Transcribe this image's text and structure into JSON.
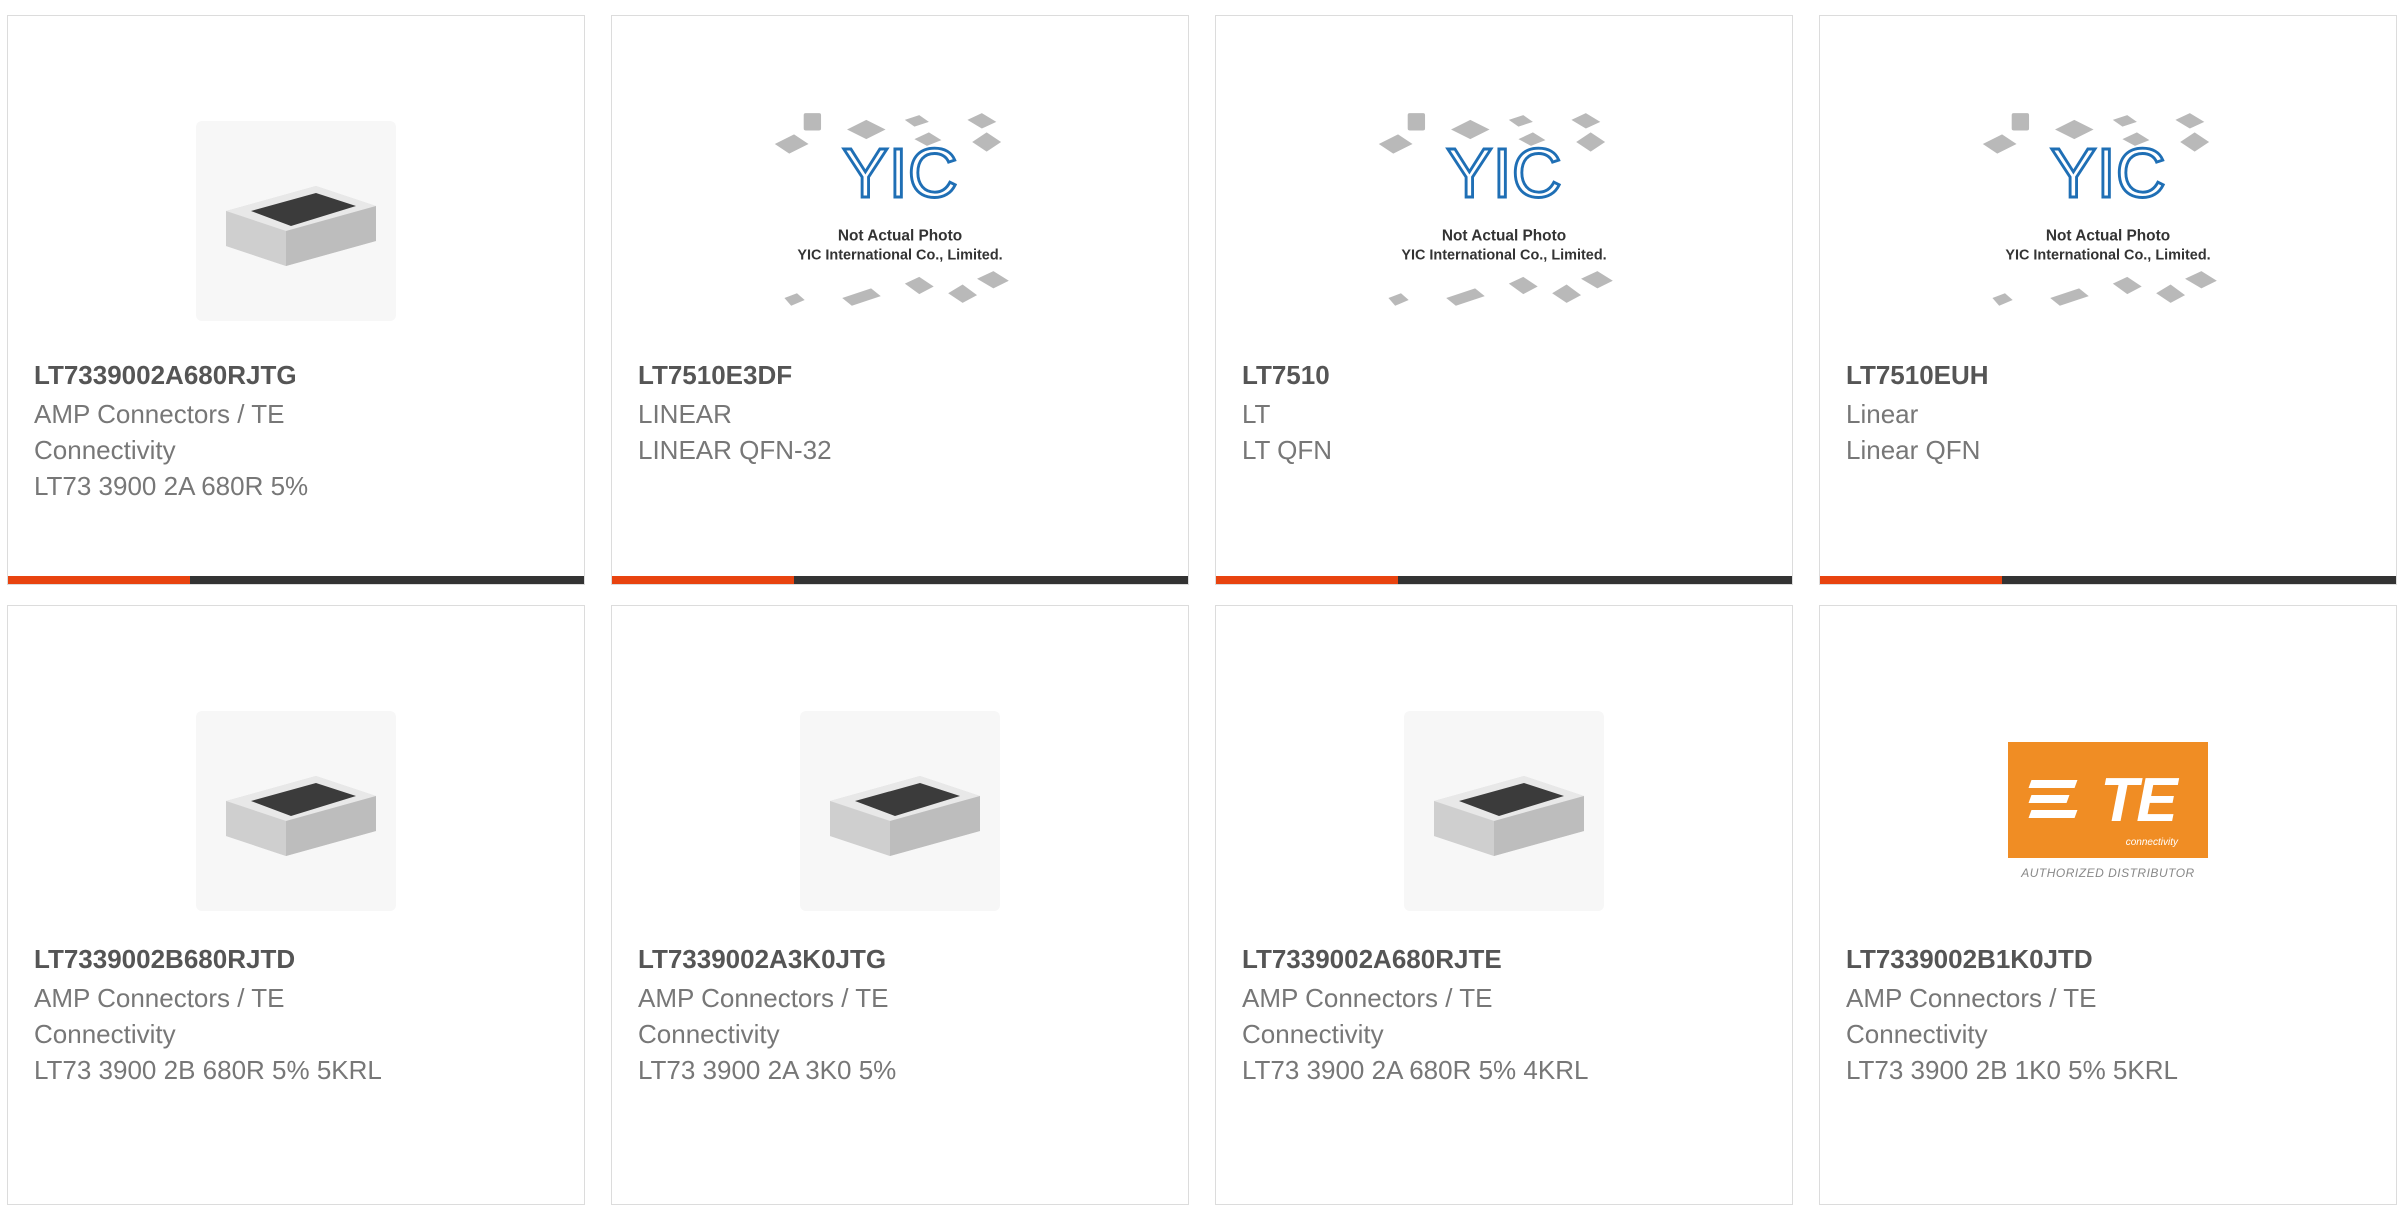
{
  "products": [
    {
      "part": "LT7339002A680RJTG",
      "lines": [
        "AMP Connectors / TE",
        "Connectivity",
        "LT73 3900 2A 680R 5%"
      ],
      "image": "resistor-chip"
    },
    {
      "part": "LT7510E3DF",
      "lines": [
        "LINEAR",
        "LINEAR QFN-32"
      ],
      "image": "yic-placeholder"
    },
    {
      "part": "LT7510",
      "lines": [
        "LT",
        "LT QFN"
      ],
      "image": "yic-placeholder"
    },
    {
      "part": "LT7510EUH",
      "lines": [
        "Linear",
        "Linear QFN"
      ],
      "image": "yic-placeholder"
    },
    {
      "part": "LT7339002B680RJTD",
      "lines": [
        "AMP Connectors / TE",
        "Connectivity",
        "LT73 3900 2B 680R 5% 5KRL"
      ],
      "image": "resistor-chip"
    },
    {
      "part": "LT7339002A3K0JTG",
      "lines": [
        "AMP Connectors / TE",
        "Connectivity",
        "LT73 3900 2A 3K0 5%"
      ],
      "image": "resistor-chip"
    },
    {
      "part": "LT7339002A680RJTE",
      "lines": [
        "AMP Connectors / TE",
        "Connectivity",
        "LT73 3900 2A 680R 5% 4KRL"
      ],
      "image": "resistor-chip"
    },
    {
      "part": "LT7339002B1K0JTD",
      "lines": [
        "AMP Connectors / TE",
        "Connectivity",
        "LT73 3900 2B 1K0 5% 5KRL"
      ],
      "image": "te-logo"
    }
  ],
  "yic": {
    "brand": "YIC",
    "line1": "Not Actual Photo",
    "line2": "YIC International Co., Limited."
  },
  "te": {
    "brand": "TE",
    "sub": "connectivity",
    "authorized": "AUTHORIZED DISTRIBUTOR"
  },
  "colors": {
    "accent": "#e8430f",
    "bar": "#333333",
    "te_orange": "#f08d24",
    "yic_blue": "#1f6fb5"
  }
}
